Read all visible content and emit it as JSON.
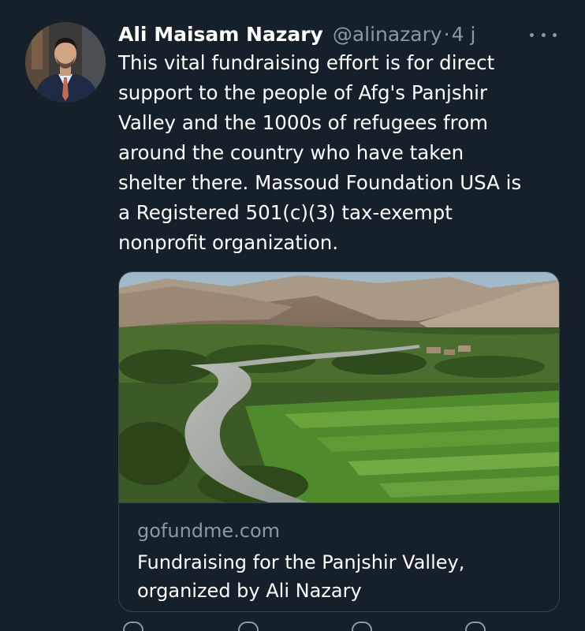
{
  "tweet": {
    "display_name": "Ali Maisam Nazary",
    "handle": "@alinazary",
    "separator": "·",
    "time": "4 j",
    "text": "This vital fundraising effort is for direct\nsupport to the people of Afg's Panjshir\nValley and the 1000s of refugees from\naround the country who have taken\nshelter there. Massoud Foundation USA is\na Registered 501(c)(3) tax-exempt\nnonprofit organization."
  },
  "card": {
    "domain": "gofundme.com",
    "title": "Fundraising for the Panjshir Valley,\norganized by Ali Nazary"
  },
  "colors": {
    "background": "#15202b",
    "primary_text": "#ffffff",
    "secondary_text": "#8b98a5",
    "border": "#38444d"
  },
  "icons": {
    "more": "more-horizontal-icon",
    "reply": "reply-icon",
    "retweet": "retweet-icon",
    "like": "heart-icon",
    "share": "share-icon"
  }
}
